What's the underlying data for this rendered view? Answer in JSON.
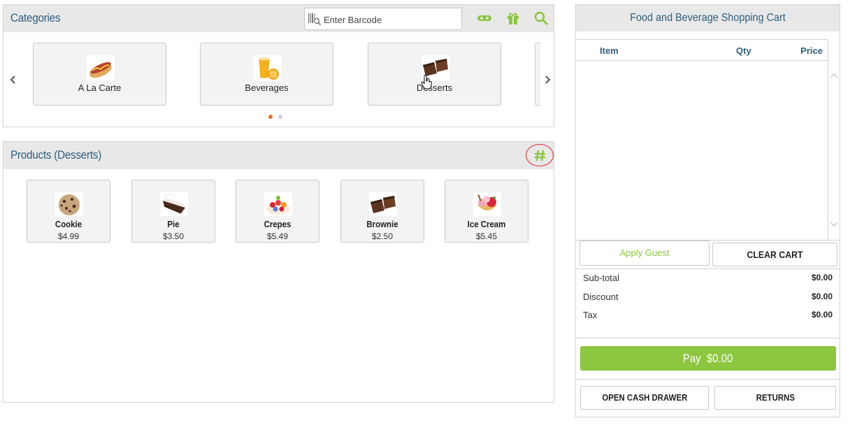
{
  "categories_panel": {
    "title": "Categories",
    "barcode_placeholder": "Enter Barcode",
    "header_icons": [
      "ticket-icon",
      "gift-icon",
      "search-icon"
    ],
    "items": [
      {
        "label": "A La Carte",
        "icon": "hotdog-icon"
      },
      {
        "label": "Beverages",
        "icon": "orange-juice-icon"
      },
      {
        "label": "Desserts",
        "icon": "brownie-icon"
      }
    ],
    "pager": {
      "pages": 2,
      "current": 1
    }
  },
  "products_panel": {
    "title": "Products (Desserts)",
    "grid_icon": "hash-icon",
    "items": [
      {
        "name": "Cookie",
        "price": "$4.99",
        "icon": "cookie-icon"
      },
      {
        "name": "Pie",
        "price": "$3.50",
        "icon": "pie-icon"
      },
      {
        "name": "Crepes",
        "price": "$5.49",
        "icon": "crepes-icon"
      },
      {
        "name": "Brownie",
        "price": "$2.50",
        "icon": "brownie-icon"
      },
      {
        "name": "Ice Cream",
        "price": "$5.45",
        "icon": "ice-cream-icon"
      }
    ]
  },
  "cart": {
    "title": "Food and Beverage Shopping Cart",
    "columns": {
      "item": "Item",
      "qty": "Qty",
      "price": "Price"
    },
    "items": [],
    "apply_guest": "Apply Guest",
    "clear_cart": "CLEAR CART",
    "summary": {
      "subtotal_label": "Sub-total",
      "subtotal": "$0.00",
      "discount_label": "Discount",
      "discount": "$0.00",
      "tax_label": "Tax",
      "tax": "$0.00"
    },
    "pay_label": "Pay  $0.00",
    "open_drawer": "OPEN CASH DRAWER",
    "returns": "RETURNS"
  },
  "colors": {
    "accent_green": "#8dc63f",
    "title_blue": "#2f5f7d",
    "pager_active": "#e8702a",
    "highlight_red": "#d9272a"
  }
}
